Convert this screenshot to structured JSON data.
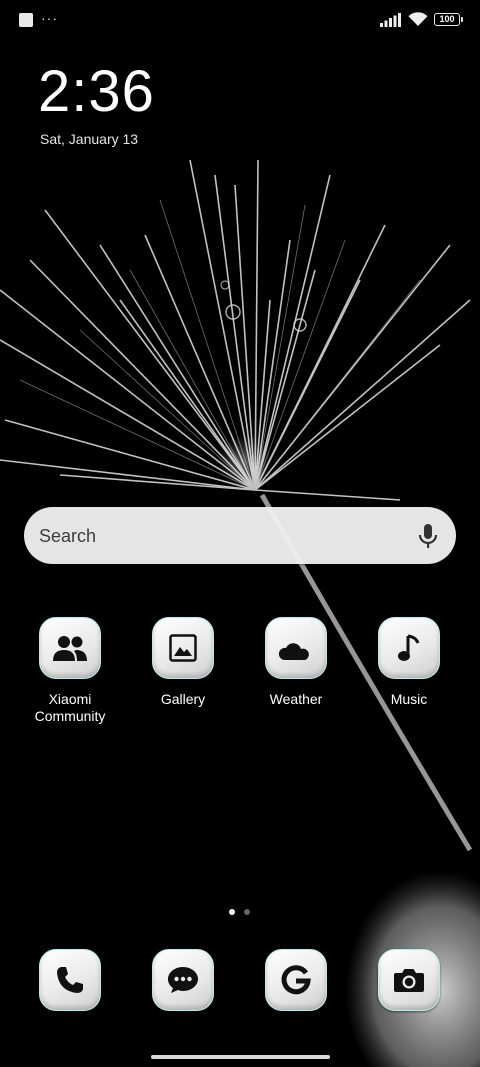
{
  "status_bar": {
    "more_indicator": "···",
    "battery_level": "100",
    "signal_icon": "signal-bars-icon",
    "wifi_icon": "wifi-icon"
  },
  "lock": {
    "time": "2:36",
    "date": "Sat, January 13"
  },
  "search": {
    "placeholder": "Search",
    "mic_icon": "microphone-icon"
  },
  "apps": [
    {
      "label": "Xiaomi\nCommunity",
      "icon": "people-icon"
    },
    {
      "label": "Gallery",
      "icon": "image-icon"
    },
    {
      "label": "Weather",
      "icon": "cloud-moon-icon"
    },
    {
      "label": "Music",
      "icon": "music-note-icon"
    }
  ],
  "dock": [
    {
      "icon": "phone-icon"
    },
    {
      "icon": "message-icon"
    },
    {
      "icon": "google-icon"
    },
    {
      "icon": "camera-icon"
    }
  ],
  "pages": {
    "count": 2,
    "active": 1
  },
  "colors": {
    "tile_border": "#b7ecec",
    "tile_bg": "#ececec",
    "glyph": "#111111",
    "background": "#000000"
  }
}
